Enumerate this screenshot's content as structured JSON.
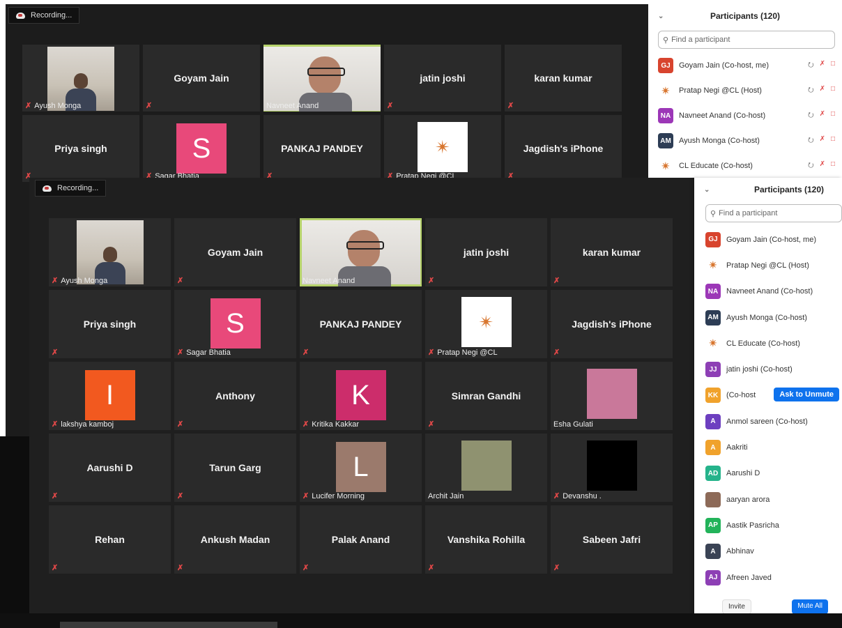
{
  "recording_label": "Recording...",
  "participants_title": "Participants (120)",
  "search_placeholder": "Find a participant",
  "back_tiles": [
    {
      "name": "Ayush Monga",
      "kind": "camera"
    },
    {
      "name": "Goyam Jain",
      "kind": "name"
    },
    {
      "name": "Navneet Anand",
      "kind": "camera-active"
    },
    {
      "name": "jatin joshi",
      "kind": "name"
    },
    {
      "name": "karan kumar",
      "kind": "name"
    },
    {
      "name": "Priya singh",
      "kind": "name"
    },
    {
      "name": "Sagar Bhatia",
      "kind": "avatar",
      "letter": "S",
      "color": "#e8497a"
    },
    {
      "name": "PANKAJ PANDEY",
      "kind": "name"
    },
    {
      "name": "Pratap Negi @CL",
      "kind": "logo"
    },
    {
      "name": "Jagdish's iPhone",
      "kind": "name"
    }
  ],
  "front_tiles": [
    {
      "name": "Ayush Monga",
      "kind": "camera"
    },
    {
      "name": "Goyam Jain",
      "kind": "name"
    },
    {
      "name": "Navneet Anand",
      "kind": "camera-active"
    },
    {
      "name": "jatin joshi",
      "kind": "name"
    },
    {
      "name": "karan kumar",
      "kind": "name"
    },
    {
      "name": "Priya singh",
      "kind": "name"
    },
    {
      "name": "Sagar Bhatia",
      "kind": "avatar",
      "letter": "S",
      "color": "#e8497a"
    },
    {
      "name": "PANKAJ PANDEY",
      "kind": "name"
    },
    {
      "name": "Pratap Negi @CL",
      "kind": "logo"
    },
    {
      "name": "Jagdish's iPhone",
      "kind": "name"
    },
    {
      "name": "lakshya kamboj",
      "kind": "avatar",
      "letter": "I",
      "color": "#f2591f"
    },
    {
      "name": "Anthony",
      "kind": "name"
    },
    {
      "name": "Kritika Kakkar",
      "kind": "avatar",
      "letter": "K",
      "color": "#cc2d6b"
    },
    {
      "name": "Simran Gandhi",
      "kind": "name"
    },
    {
      "name": "Esha Gulati",
      "kind": "photo",
      "color": "#c9789a"
    },
    {
      "name": "Aarushi D",
      "kind": "name"
    },
    {
      "name": "Tarun Garg",
      "kind": "name"
    },
    {
      "name": "Lucifer Morning",
      "kind": "avatar",
      "letter": "L",
      "color": "#9b7a6c"
    },
    {
      "name": "Archit Jain",
      "kind": "photo",
      "color": "#8f9270"
    },
    {
      "name": "Devanshu .",
      "kind": "photo",
      "color": "#000000"
    },
    {
      "name": "Rehan",
      "kind": "name"
    },
    {
      "name": "Ankush Madan",
      "kind": "name"
    },
    {
      "name": "Palak Anand",
      "kind": "name"
    },
    {
      "name": "Vanshika Rohilla",
      "kind": "name"
    },
    {
      "name": "Sabeen Jafri",
      "kind": "name"
    }
  ],
  "back_participants": [
    {
      "initials": "GJ",
      "label": "Goyam Jain (Co-host, me)",
      "color": "#d8442e"
    },
    {
      "initials": "",
      "label": "Pratap Negi  @CL (Host)",
      "color": "logo"
    },
    {
      "initials": "NA",
      "label": "Navneet Anand (Co-host)",
      "color": "#9c37b7"
    },
    {
      "initials": "AM",
      "label": "Ayush Monga (Co-host)",
      "color": "#2d3d55"
    },
    {
      "initials": "",
      "label": "CL Educate (Co-host)",
      "color": "logo"
    }
  ],
  "front_participants": [
    {
      "initials": "GJ",
      "label": "Goyam Jain (Co-host, me)",
      "color": "#d8442e"
    },
    {
      "initials": "",
      "label": "Pratap Negi  @CL (Host)",
      "color": "logo"
    },
    {
      "initials": "NA",
      "label": "Navneet Anand (Co-host)",
      "color": "#9c37b7"
    },
    {
      "initials": "AM",
      "label": "Ayush Monga (Co-host)",
      "color": "#2d3d55"
    },
    {
      "initials": "",
      "label": "CL Educate (Co-host)",
      "color": "logo"
    },
    {
      "initials": "JJ",
      "label": "jatin joshi (Co-host)",
      "color": "#8d3fb5"
    },
    {
      "initials": "KK",
      "label": "(Co-host",
      "color": "#f0a22c"
    },
    {
      "initials": "A",
      "label": "Anmol sareen (Co-host)",
      "color": "#6d3fc0"
    },
    {
      "initials": "A",
      "label": "Aakriti",
      "color": "#f0a22c"
    },
    {
      "initials": "AD",
      "label": "Aarushi D",
      "color": "#25b38b"
    },
    {
      "initials": "",
      "label": "aaryan arora",
      "color": "pic"
    },
    {
      "initials": "AP",
      "label": "Aastik Pasricha",
      "color": "#22b35a"
    },
    {
      "initials": "A",
      "label": "Abhinav",
      "color": "#3a4355"
    },
    {
      "initials": "AJ",
      "label": "Afreen Javed",
      "color": "#8d3fb5"
    }
  ],
  "ask_to_unmute": "Ask to Unmute",
  "invite_label": "Invite",
  "mute_all_label": "Mute All"
}
